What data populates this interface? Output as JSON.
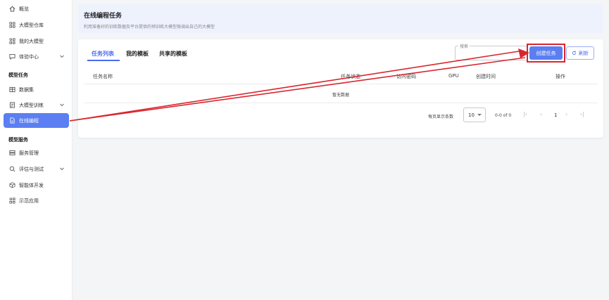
{
  "sidebar": {
    "items": [
      {
        "label": "概览",
        "icon": "home-icon"
      },
      {
        "label": "大模型仓库",
        "icon": "grid-icon"
      },
      {
        "label": "我的大模型",
        "icon": "apps-icon"
      },
      {
        "label": "体验中心",
        "icon": "chat-icon"
      }
    ],
    "section_task": "模型任务",
    "task_items": [
      {
        "label": "数据集",
        "icon": "table-icon"
      },
      {
        "label": "大模型训练",
        "icon": "document-icon"
      },
      {
        "label": "在线编程",
        "icon": "file-icon"
      }
    ],
    "section_service": "模型服务",
    "service_items": [
      {
        "label": "服务管理",
        "icon": "server-icon"
      },
      {
        "label": "评估与测试",
        "icon": "search-chart-icon"
      },
      {
        "label": "智能体开发",
        "icon": "cube-icon"
      },
      {
        "label": "示范应用",
        "icon": "apps-icon"
      }
    ]
  },
  "header": {
    "title": "在线编程任务",
    "subtitle": "利用准备好的训练数据及平台提供的预训练大模型微调出自己的大模型"
  },
  "tabs": [
    "任务列表",
    "我的模板",
    "共享的模板"
  ],
  "search": {
    "label": "搜索"
  },
  "toolbar": {
    "create_label": "创建任务",
    "refresh_label": "刷新"
  },
  "table": {
    "columns": [
      "任务名称",
      "任务状态",
      "访问密码",
      "GPU",
      "创建时间",
      "操作"
    ],
    "empty_text": "暂无数据"
  },
  "pagination": {
    "rows_label": "每页显示条数",
    "rows_value": "10",
    "range": "0-0 of 0",
    "page": "1"
  },
  "colors": {
    "accent": "#5b7ff2",
    "highlight": "#d9262e"
  }
}
